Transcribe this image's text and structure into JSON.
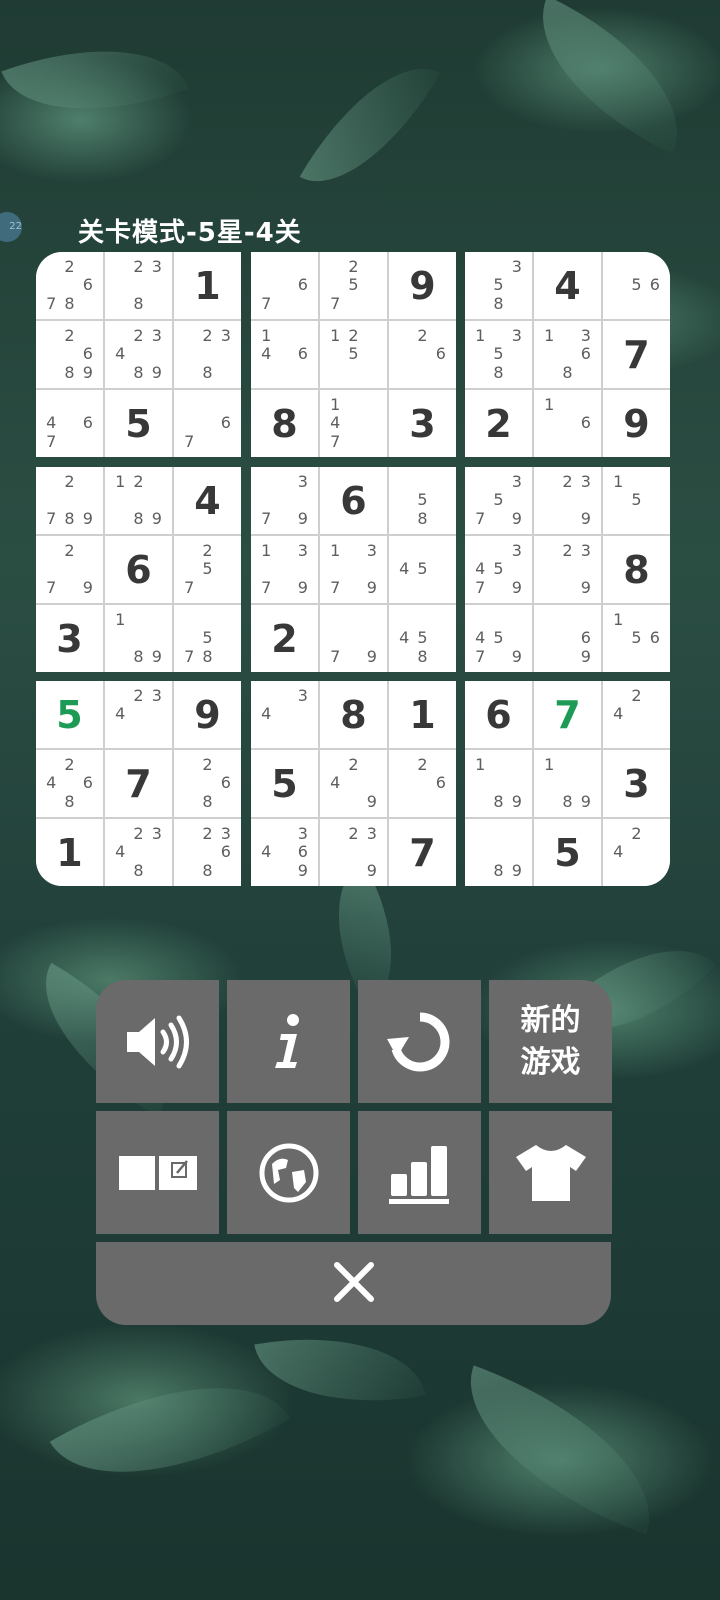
{
  "level_title": "关卡模式-5星-4关",
  "side_badge": "22",
  "board": [
    [
      {
        "c": [
          2,
          6,
          7,
          8
        ]
      },
      {
        "c": [
          2,
          3,
          8
        ]
      },
      {
        "v": 1
      },
      {
        "c": [
          6,
          7
        ]
      },
      {
        "c": [
          2,
          5,
          7
        ]
      },
      {
        "v": 9
      },
      {
        "c": [
          3,
          5,
          8
        ]
      },
      {
        "v": 4
      },
      {
        "c": [
          5,
          6
        ]
      }
    ],
    [
      {
        "c": [
          2,
          6,
          8,
          9
        ]
      },
      {
        "c": [
          2,
          3,
          4,
          8,
          9
        ]
      },
      {
        "c": [
          2,
          3,
          8
        ]
      },
      {
        "c": [
          1,
          4,
          6
        ]
      },
      {
        "c": [
          1,
          2,
          5
        ]
      },
      {
        "c": [
          2,
          6
        ]
      },
      {
        "c": [
          1,
          3,
          5,
          8
        ]
      },
      {
        "c": [
          1,
          3,
          6,
          8
        ]
      },
      {
        "v": 7
      }
    ],
    [
      {
        "c": [
          4,
          6,
          7
        ]
      },
      {
        "v": 5
      },
      {
        "c": [
          6,
          7
        ]
      },
      {
        "v": 8
      },
      {
        "c": [
          1,
          4,
          7
        ]
      },
      {
        "v": 3
      },
      {
        "v": 2
      },
      {
        "c": [
          1,
          6
        ]
      },
      {
        "v": 9
      }
    ],
    [
      {
        "c": [
          2,
          7,
          8,
          9
        ]
      },
      {
        "c": [
          1,
          2,
          8,
          9
        ]
      },
      {
        "v": 4
      },
      {
        "c": [
          3,
          7,
          9
        ]
      },
      {
        "v": 6
      },
      {
        "c": [
          5,
          8
        ]
      },
      {
        "c": [
          3,
          5,
          7,
          9
        ]
      },
      {
        "c": [
          2,
          3,
          9
        ]
      },
      {
        "c": [
          1,
          5
        ]
      }
    ],
    [
      {
        "c": [
          2,
          7,
          9
        ]
      },
      {
        "v": 6
      },
      {
        "c": [
          2,
          5,
          7
        ]
      },
      {
        "c": [
          1,
          3,
          7,
          9
        ]
      },
      {
        "c": [
          1,
          3,
          7,
          9
        ]
      },
      {
        "c": [
          4,
          5
        ]
      },
      {
        "c": [
          3,
          4,
          5,
          7,
          9
        ]
      },
      {
        "c": [
          2,
          3,
          9
        ]
      },
      {
        "v": 8
      }
    ],
    [
      {
        "v": 3
      },
      {
        "c": [
          1,
          8,
          9
        ]
      },
      {
        "c": [
          5,
          7,
          8
        ]
      },
      {
        "v": 2
      },
      {
        "c": [
          7,
          9
        ]
      },
      {
        "c": [
          4,
          5,
          8
        ]
      },
      {
        "c": [
          4,
          5,
          7,
          9
        ]
      },
      {
        "c": [
          6,
          9
        ]
      },
      {
        "c": [
          1,
          5,
          6
        ]
      }
    ],
    [
      {
        "v": 5,
        "u": true
      },
      {
        "c": [
          2,
          3,
          4
        ]
      },
      {
        "v": 9
      },
      {
        "c": [
          3,
          4
        ]
      },
      {
        "v": 8
      },
      {
        "v": 1
      },
      {
        "v": 6
      },
      {
        "v": 7,
        "u": true
      },
      {
        "c": [
          2,
          4
        ]
      }
    ],
    [
      {
        "c": [
          2,
          4,
          6,
          8
        ]
      },
      {
        "v": 7
      },
      {
        "c": [
          2,
          6,
          8
        ]
      },
      {
        "v": 5
      },
      {
        "c": [
          2,
          4,
          9
        ]
      },
      {
        "c": [
          2,
          6
        ]
      },
      {
        "c": [
          1,
          8,
          9
        ]
      },
      {
        "c": [
          1,
          8,
          9
        ]
      },
      {
        "v": 3
      }
    ],
    [
      {
        "v": 1
      },
      {
        "c": [
          2,
          3,
          4,
          8
        ]
      },
      {
        "c": [
          2,
          3,
          6,
          8
        ]
      },
      {
        "c": [
          3,
          4,
          6,
          9
        ]
      },
      {
        "c": [
          2,
          3,
          9
        ]
      },
      {
        "v": 7
      },
      {
        "c": [
          8,
          9
        ]
      },
      {
        "v": 5
      },
      {
        "c": [
          2,
          4
        ]
      }
    ]
  ],
  "menu": {
    "sound_icon": "speaker-icon",
    "info_icon": "info-icon",
    "restart_icon": "restart-icon",
    "new_game_label_line1": "新的",
    "new_game_label_line2": "游戏",
    "notes_icon": "notes-toggle-icon",
    "globe_icon": "globe-icon",
    "stats_icon": "bar-chart-icon",
    "theme_icon": "tshirt-icon",
    "close_icon": "close-icon"
  },
  "colors": {
    "given_digit": "#383838",
    "user_digit": "#1e9a57",
    "candidate": "#5e5e5e",
    "menu_button": "#6a6a6a"
  }
}
